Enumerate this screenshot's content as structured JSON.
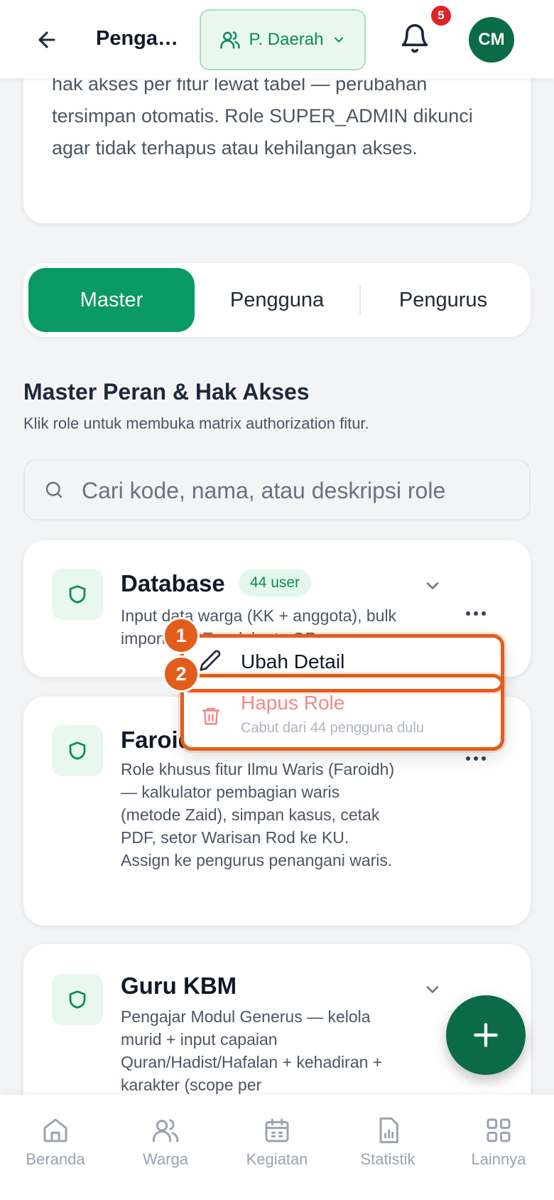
{
  "header": {
    "title": "Pengat…",
    "scope_label": "P. Daerah",
    "notification_count": "5",
    "avatar_initials": "CM"
  },
  "info_card": {
    "text": "hak akses per fitur lewat tabel — perubahan tersimpan otomatis. Role SUPER_ADMIN dikunci agar tidak terhapus atau kehilangan akses."
  },
  "tabs": [
    {
      "label": "Master",
      "active": true
    },
    {
      "label": "Pengguna",
      "active": false
    },
    {
      "label": "Pengurus",
      "active": false
    }
  ],
  "section": {
    "title": "Master Peran & Hak Akses",
    "subtitle": "Klik role untuk membuka matrix authorization fitur."
  },
  "search": {
    "placeholder": "Cari kode, nama, atau deskripsi role"
  },
  "roles": [
    {
      "name": "Database",
      "badge": "44 user",
      "description": "Input data warga (KK + anggota), bulk import dari Excel, kartu QR."
    },
    {
      "name": "Faroidh",
      "badge": "",
      "description": "Role khusus fitur Ilmu Waris (Faroidh) — kalkulator pembagian waris (metode Zaid), simpan kasus, cetak PDF, setor Warisan Rod ke KU. Assign ke pengurus penangani waris."
    },
    {
      "name": "Guru KBM",
      "badge": "",
      "description": "Pengajar Modul Generus — kelola murid + input capaian Quran/Hadist/Hafalan + kehadiran + karakter (scope per"
    }
  ],
  "menu": {
    "edit_label": "Ubah Detail",
    "delete_label": "Hapus Role",
    "delete_hint": "Cabut dari 44 pengguna dulu"
  },
  "annotations": {
    "marker_1": "1",
    "marker_2": "2"
  },
  "bottom_nav": [
    {
      "label": "Beranda",
      "icon": "home-icon"
    },
    {
      "label": "Warga",
      "icon": "users-icon"
    },
    {
      "label": "Kegiatan",
      "icon": "calendar-icon"
    },
    {
      "label": "Statistik",
      "icon": "chart-icon"
    },
    {
      "label": "Lainnya",
      "icon": "grid-icon"
    }
  ],
  "colors": {
    "primary": "#0a9a63",
    "primary_dark": "#0b6b48",
    "danger": "#dc2626",
    "annotation": "#e25d1c"
  }
}
